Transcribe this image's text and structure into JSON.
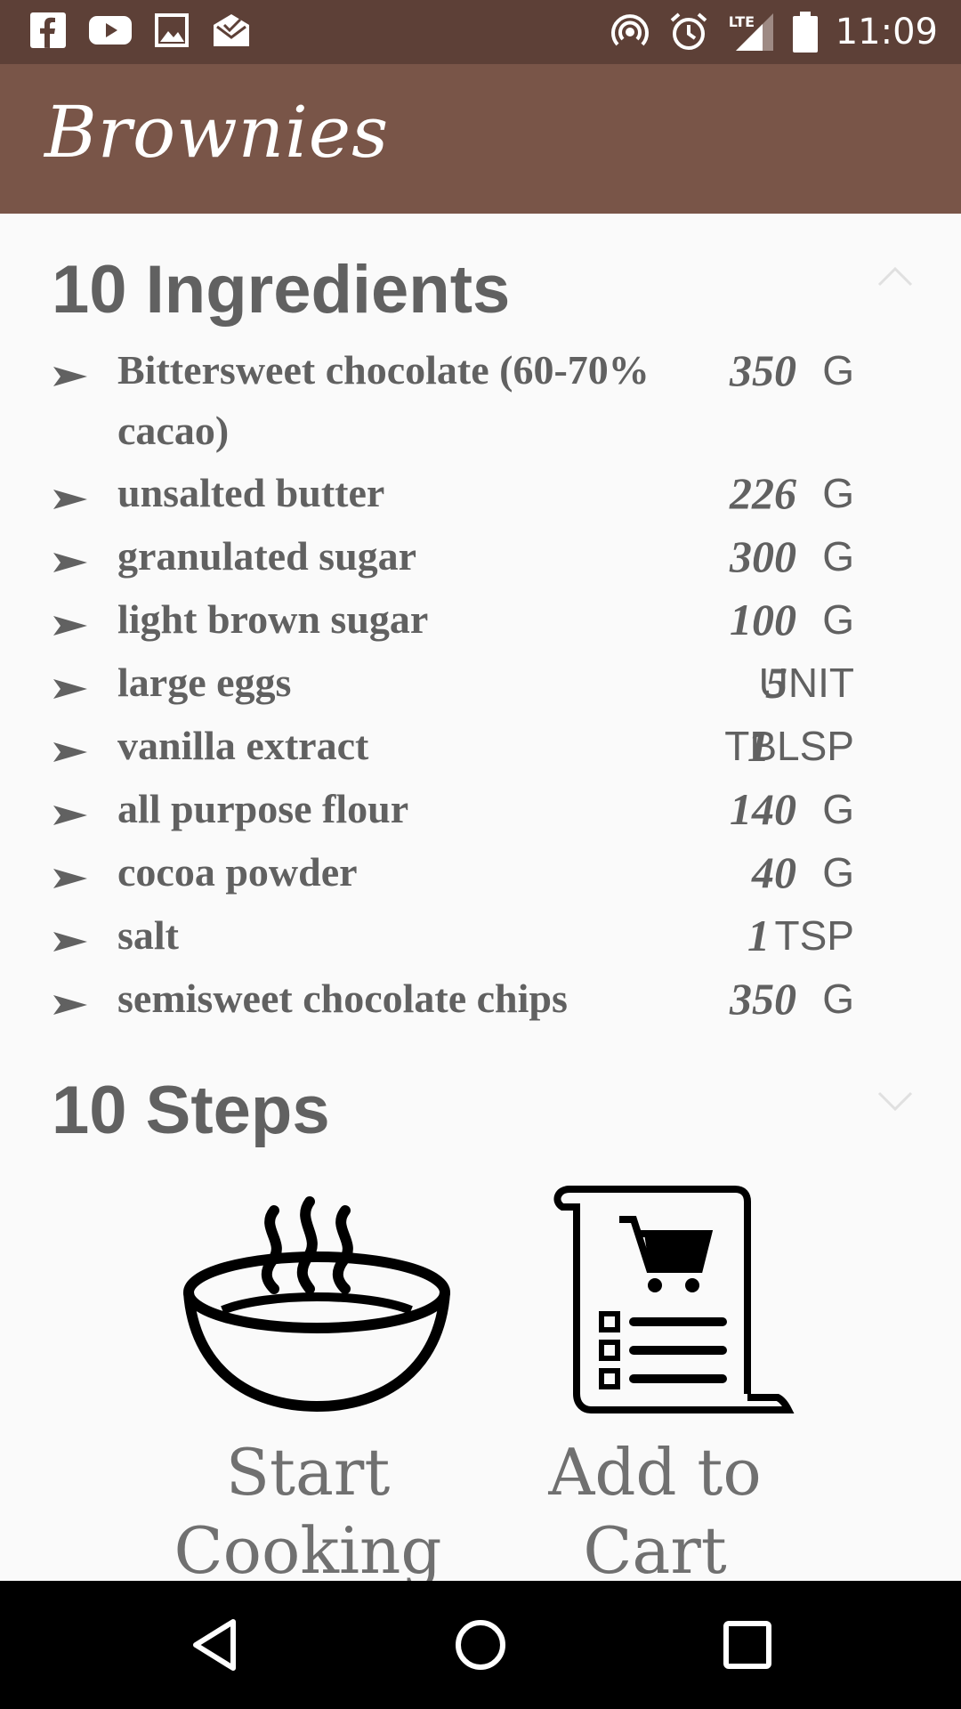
{
  "status_bar": {
    "time": "11:09",
    "network_label": "LTE",
    "left_icons": [
      "facebook-icon",
      "youtube-icon",
      "gallery-icon",
      "mail-icon"
    ],
    "right_icons": [
      "hotspot-icon",
      "alarm-icon",
      "signal-icon",
      "battery-icon"
    ]
  },
  "app_bar": {
    "title": "Brownies",
    "color": "#795548",
    "status_color": "#5d4037"
  },
  "ingredients": {
    "header": "10 Ingredients",
    "items": [
      {
        "name": "Bittersweet chocolate (60-70% cacao)",
        "qty": "350",
        "unit": "G"
      },
      {
        "name": "unsalted butter",
        "qty": "226",
        "unit": "G"
      },
      {
        "name": "granulated sugar",
        "qty": "300",
        "unit": "G"
      },
      {
        "name": "light brown sugar",
        "qty": "100",
        "unit": "G"
      },
      {
        "name": "large eggs",
        "qty": "5",
        "unit": "UNIT"
      },
      {
        "name": "vanilla extract",
        "qty": "1",
        "unit": "TBLSP"
      },
      {
        "name": "all purpose flour",
        "qty": "140",
        "unit": "G"
      },
      {
        "name": "cocoa powder",
        "qty": "40",
        "unit": "G"
      },
      {
        "name": "salt",
        "qty": "1",
        "unit": "TSP"
      },
      {
        "name": "semisweet chocolate chips",
        "qty": "350",
        "unit": "G"
      }
    ]
  },
  "steps": {
    "header": "10 Steps"
  },
  "actions": {
    "start_cooking": "Start Cooking",
    "add_to_cart": "Add to Cart"
  },
  "text_color": "#616161"
}
